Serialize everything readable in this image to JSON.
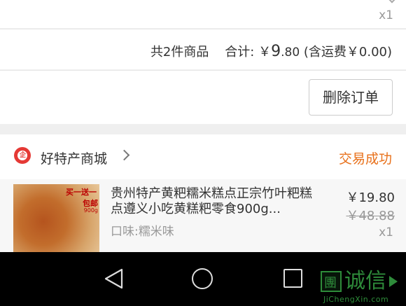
{
  "top_item": {
    "quantity": "x1"
  },
  "summary": {
    "count_text": "共2件商品",
    "total_label": "合计:",
    "currency": "￥",
    "total_int": "9",
    "total_dec": ".80",
    "shipping_text": "(含运费￥0.00)"
  },
  "actions": {
    "delete_label": "删除订单"
  },
  "store": {
    "logo_mark": "企",
    "name": "好特产商城",
    "status": "交易成功",
    "status_color": "#e8701a"
  },
  "product": {
    "title": "贵州特产黄粑糯米糕点正宗竹叶粑糕点遵义小吃黄糕粑零食900g...",
    "spec": "口味:糯米味",
    "price": "￥19.80",
    "original_price": "￥48.88",
    "quantity": "x1",
    "thumb_promo_line1": "买一送一",
    "thumb_promo_line2": "包邮",
    "thumb_promo_line3": "900g"
  },
  "navbar": {
    "icons": [
      "back-icon",
      "home-icon",
      "recent-apps-icon"
    ]
  },
  "watermark": {
    "box_char": "團",
    "text": "诚信",
    "url": "JiChengXin.com"
  }
}
